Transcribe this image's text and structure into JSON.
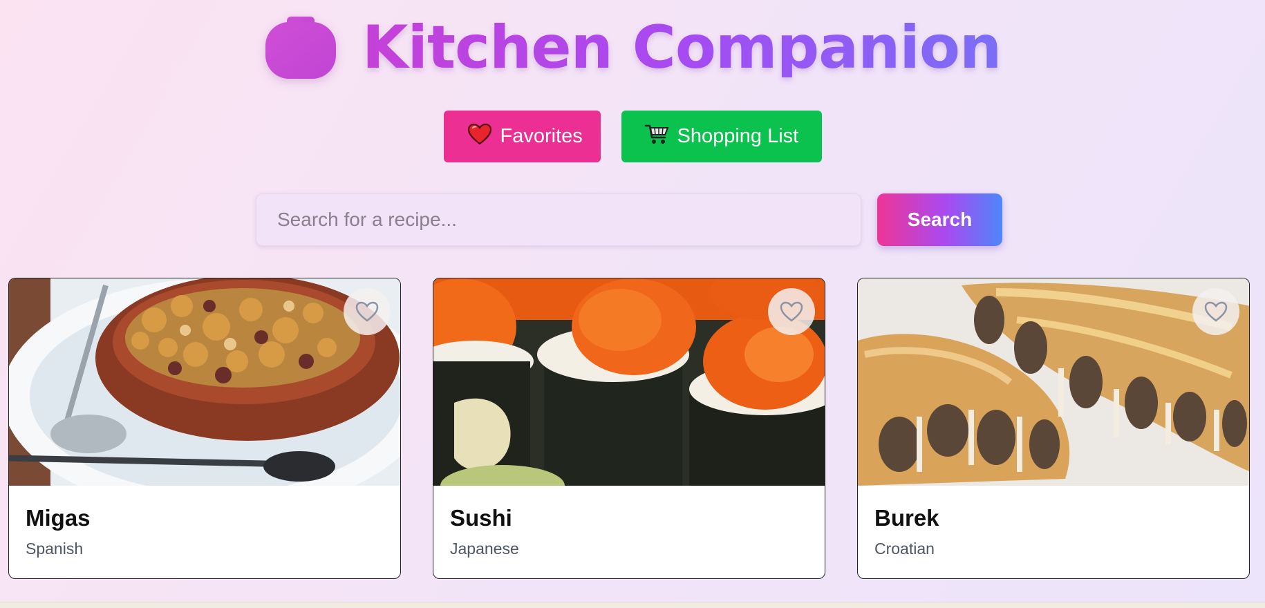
{
  "header": {
    "title": "Kitchen Companion",
    "logo_icon": "cooking-pot-icon"
  },
  "nav": {
    "favorites": {
      "label": "Favorites",
      "icon": "heart-icon",
      "color": "#ec2f93"
    },
    "shopping": {
      "label": "Shopping List",
      "icon": "shopping-cart-icon",
      "color": "#0bc24e"
    }
  },
  "search": {
    "placeholder": "Search for a recipe...",
    "value": "",
    "button_label": "Search"
  },
  "recipes": [
    {
      "name": "Migas",
      "cuisine": "Spanish",
      "favorited": false
    },
    {
      "name": "Sushi",
      "cuisine": "Japanese",
      "favorited": false
    },
    {
      "name": "Burek",
      "cuisine": "Croatian",
      "favorited": false
    }
  ],
  "colors": {
    "accent_pink": "#ec2f93",
    "accent_green": "#0bc24e",
    "title_gradient_start": "#c541d8",
    "title_gradient_end": "#7a6ef6"
  }
}
